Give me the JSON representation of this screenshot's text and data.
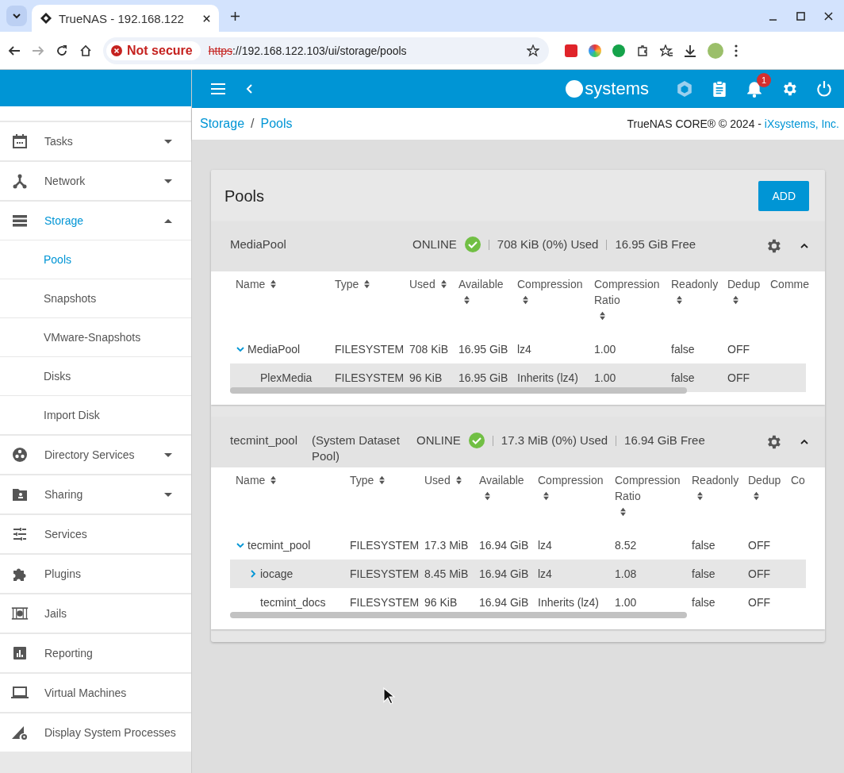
{
  "browser": {
    "tab_title": "TrueNAS - 192.168.122",
    "security": "Not secure",
    "url_scheme": "https",
    "url_rest": "://192.168.122.103/ui/storage/pools"
  },
  "header": {
    "logo": "systems",
    "notifications": "1"
  },
  "sidebar": {
    "items": [
      {
        "label": "Tasks",
        "kind": "calendar",
        "selected": false,
        "expanded": false
      },
      {
        "label": "Network",
        "kind": "network",
        "selected": false,
        "expanded": false
      },
      {
        "label": "Storage",
        "kind": "storage",
        "selected": true,
        "expanded": true
      },
      {
        "label": "Pools",
        "kind": "subitem",
        "selected": true
      },
      {
        "label": "Snapshots",
        "kind": "subitem",
        "selected": false
      },
      {
        "label": "VMware-Snapshots",
        "kind": "subitem",
        "selected": false
      },
      {
        "label": "Disks",
        "kind": "subitem",
        "selected": false
      },
      {
        "label": "Import Disk",
        "kind": "subitem",
        "selected": false
      },
      {
        "label": "Directory Services",
        "kind": "directory",
        "selected": false,
        "expanded": false
      },
      {
        "label": "Sharing",
        "kind": "sharing",
        "selected": false,
        "expanded": false
      },
      {
        "label": "Services",
        "kind": "services",
        "selected": false
      },
      {
        "label": "Plugins",
        "kind": "plugins",
        "selected": false
      },
      {
        "label": "Jails",
        "kind": "jails",
        "selected": false
      },
      {
        "label": "Reporting",
        "kind": "reporting",
        "selected": false
      },
      {
        "label": "Virtual Machines",
        "kind": "vm",
        "selected": false
      },
      {
        "label": "Display System Processes",
        "kind": "processes",
        "selected": false
      }
    ]
  },
  "breadcrumb": [
    "Storage",
    "Pools"
  ],
  "breadcrumb_separator": "/",
  "copyright": {
    "text": "TrueNAS CORE® © 2024 - ",
    "link": "iXsystems, Inc."
  },
  "page_title": "Pools",
  "add_button": "ADD",
  "pools": [
    {
      "name": "MediaPool",
      "status": "ONLINE",
      "used": "708 KiB (0%) Used",
      "free": "16.95 GiB Free",
      "expanded": true,
      "columns": [
        "Name",
        "Type",
        "Used",
        "Available",
        "Compression",
        "Compression Ratio",
        "Readonly",
        "Dedup",
        "Comme"
      ],
      "rows": [
        {
          "cells": [
            "MediaPool",
            "FILESYSTEM",
            "708 KiB",
            "16.95 GiB",
            "lz4",
            "1.00",
            "false",
            "OFF"
          ],
          "expanded": true,
          "selected": false,
          "children": [
            {
              "cells": [
                "PlexMedia",
                "FILESYSTEM",
                "96 KiB",
                "16.95 GiB",
                "Inherits (lz4)",
                "1.00",
                "false",
                "OFF"
              ],
              "selected": true
            }
          ]
        }
      ]
    },
    {
      "name": "tecmint_pool",
      "note": "(System Dataset Pool)",
      "status": "ONLINE",
      "used": "17.3 MiB (0%) Used",
      "free": "16.94 GiB Free",
      "expanded": true,
      "columns": [
        "Name",
        "Type",
        "Used",
        "Available",
        "Compression",
        "Compression Ratio",
        "Readonly",
        "Dedup",
        "Co"
      ],
      "rows": [
        {
          "cells": [
            "tecmint_pool",
            "FILESYSTEM",
            "17.3 MiB",
            "16.94 GiB",
            "lz4",
            "8.52",
            "false",
            "OFF"
          ],
          "expanded": true,
          "selected": false,
          "children": [
            {
              "cells": [
                "iocage",
                "FILESYSTEM",
                "8.45 MiB",
                "16.94 GiB",
                "lz4",
                "1.08",
                "false",
                "OFF"
              ],
              "expanded": false,
              "selected": true
            },
            {
              "cells": [
                "tecmint_docs",
                "FILESYSTEM",
                "96 KiB",
                "16.94 GiB",
                "Inherits (lz4)",
                "1.00",
                "false",
                "OFF"
              ],
              "selected": false
            }
          ]
        }
      ]
    }
  ]
}
